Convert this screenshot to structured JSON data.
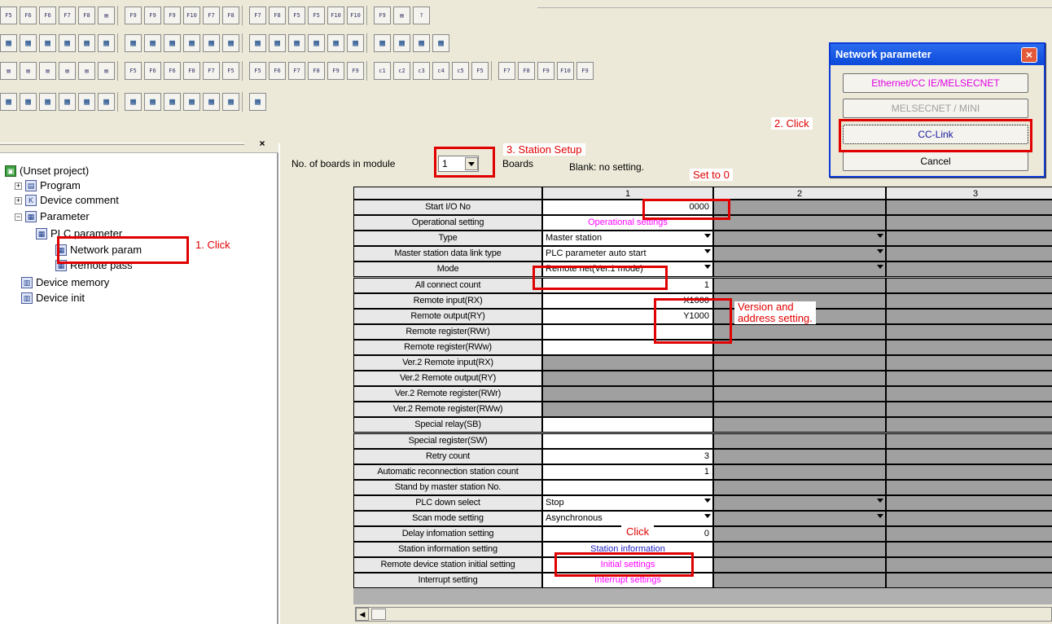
{
  "toolbar": {
    "row1": [
      "F5",
      "F6",
      "F6",
      "F7",
      "F8",
      "",
      "F9",
      "F9",
      "F9",
      "F10",
      "F7",
      "F8",
      "F7",
      "F8",
      "F5",
      "F5",
      "F10",
      "F10",
      "F9",
      "",
      "?"
    ],
    "row2": [
      "",
      "",
      "",
      "",
      "",
      "",
      "",
      "",
      "",
      "",
      "",
      "",
      "",
      "",
      "",
      "",
      "",
      "",
      "",
      "",
      "",
      ""
    ],
    "row3": [
      "",
      "",
      "",
      "",
      "",
      "",
      "F5",
      "F6",
      "F6",
      "F8",
      "F7",
      "F5",
      "F5",
      "F6",
      "F7",
      "F8",
      "F9",
      "F9",
      "c1",
      "c2",
      "c3",
      "c4",
      "c5",
      "F5",
      "F7",
      "F8",
      "F9",
      "F10",
      "F9"
    ],
    "row4": [
      "",
      "",
      "",
      "",
      "",
      "",
      "",
      "",
      "",
      "",
      "",
      "",
      ""
    ]
  },
  "tree": {
    "root": "(Unset project)",
    "items": [
      "Program",
      "Device comment",
      "Parameter",
      "PLC parameter",
      "Network param",
      "Remote pass",
      "Device memory",
      "Device init"
    ]
  },
  "module": {
    "label": "No. of boards in module",
    "value": "1",
    "suffix": "Boards",
    "blank_note": "Blank: no setting."
  },
  "grid": {
    "columns": [
      "1",
      "2",
      "3"
    ],
    "rows": [
      {
        "label": "Start I/O No",
        "v1": "0000",
        "type": "num"
      },
      {
        "label": "Operational setting",
        "v1": "Operational settings",
        "type": "pink"
      },
      {
        "label": "Type",
        "v1": "Master station",
        "type": "dd"
      },
      {
        "label": "Master station data link type",
        "v1": "PLC parameter auto start",
        "type": "dd"
      },
      {
        "label": "Mode",
        "v1": "Remote net(Ver.1 mode)",
        "type": "dd"
      },
      {
        "label": "All connect count",
        "v1": "1",
        "type": "num"
      },
      {
        "label": "Remote input(RX)",
        "v1": "X1000",
        "type": "num"
      },
      {
        "label": "Remote output(RY)",
        "v1": "Y1000",
        "type": "num"
      },
      {
        "label": "Remote register(RWr)",
        "v1": "",
        "type": "num"
      },
      {
        "label": "Remote register(RWw)",
        "v1": "",
        "type": "num"
      },
      {
        "label": "Ver.2 Remote input(RX)",
        "v1": "",
        "type": "grey"
      },
      {
        "label": "Ver.2 Remote output(RY)",
        "v1": "",
        "type": "grey"
      },
      {
        "label": "Ver.2 Remote register(RWr)",
        "v1": "",
        "type": "grey"
      },
      {
        "label": "Ver.2 Remote register(RWw)",
        "v1": "",
        "type": "grey"
      },
      {
        "label": "Special relay(SB)",
        "v1": "",
        "type": "num"
      },
      {
        "label": "Special register(SW)",
        "v1": "",
        "type": "num"
      },
      {
        "label": "Retry count",
        "v1": "3",
        "type": "num"
      },
      {
        "label": "Automatic reconnection station count",
        "v1": "1",
        "type": "num"
      },
      {
        "label": "Stand by master station No.",
        "v1": "",
        "type": "num"
      },
      {
        "label": "PLC down select",
        "v1": "Stop",
        "type": "dd"
      },
      {
        "label": "Scan mode setting",
        "v1": "Asynchronous",
        "type": "dd"
      },
      {
        "label": "Delay infomation setting",
        "v1": "0",
        "type": "num"
      },
      {
        "label": "Station information setting",
        "v1": "Station information",
        "type": "blue"
      },
      {
        "label": "Remote device station initial setting",
        "v1": "Initial settings",
        "type": "pink"
      },
      {
        "label": "Interrupt setting",
        "v1": "Interrupt settings",
        "type": "pink"
      }
    ]
  },
  "dialog": {
    "title": "Network parameter",
    "close": "×",
    "buttons": [
      "Ethernet/CC IE/MELSECNET",
      "MELSECNET / MINI",
      "CC-Link",
      "Cancel"
    ]
  },
  "annotations": {
    "click1": "1. Click",
    "click2": "2. Click",
    "station_setup": "3. Station Setup",
    "set_to_0": "Set to 0",
    "version_line1": "Version and",
    "version_line2": "address setting.",
    "click_scan": "Click"
  },
  "colors": {
    "annotation": "#e00000",
    "dialog_title": "#0c4ad8",
    "pink": "#ff00ff",
    "blue": "#2020c0"
  }
}
